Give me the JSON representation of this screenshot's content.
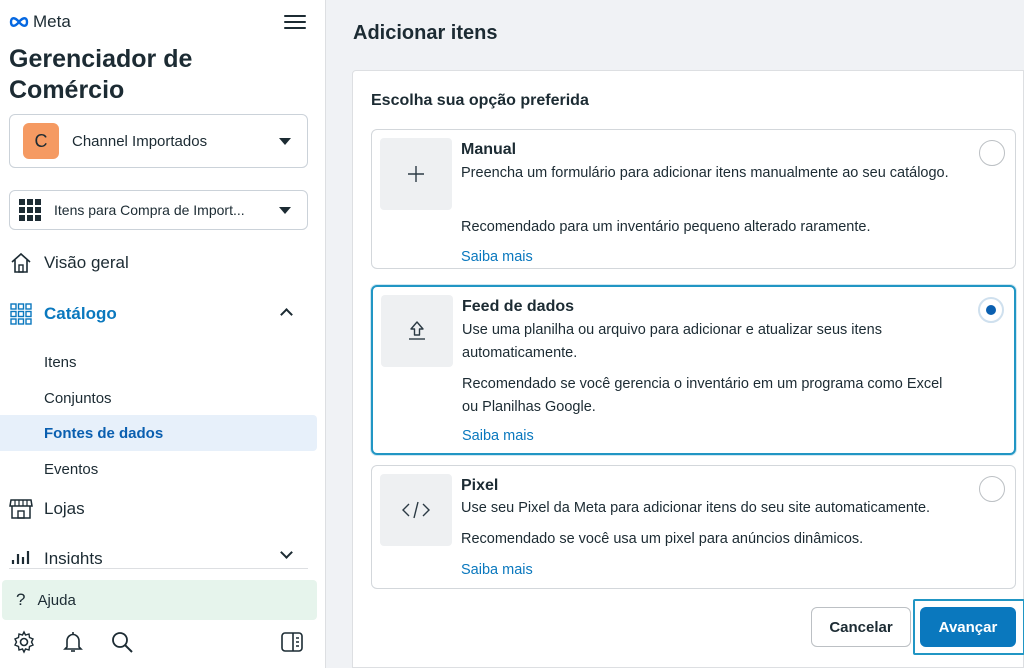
{
  "sidebar": {
    "brand": "Meta",
    "app_title": "Gerenciador de Comércio",
    "account": {
      "initial": "C",
      "name": "Channel Importados"
    },
    "catalog": {
      "name": "Itens para Compra de Import..."
    },
    "nav": {
      "overview": "Visão geral",
      "catalog": "Catálogo",
      "items": "Itens",
      "sets": "Conjuntos",
      "data_sources": "Fontes de dados",
      "events": "Eventos",
      "shops": "Lojas",
      "insights": "Insights"
    },
    "help": "Ajuda",
    "icons": [
      "gear-icon",
      "bell-icon",
      "search-icon",
      "panel-toggle-icon"
    ]
  },
  "main": {
    "title": "Adicionar itens",
    "subtitle": "Escolha sua opção preferida",
    "options": [
      {
        "title": "Manual",
        "desc": "Preencha um formulário para adicionar itens manualmente ao seu catálogo.",
        "rec": "Recomendado para um inventário pequeno alterado raramente.",
        "link": "Saiba mais",
        "icon_glyph": "+",
        "selected": false
      },
      {
        "title": "Feed de dados",
        "desc": "Use uma planilha ou arquivo para adicionar e atualizar seus itens automaticamente.",
        "rec": "Recomendado se você gerencia o inventário em um programa como Excel ou Planilhas Google.",
        "link": "Saiba mais",
        "icon_glyph": "upload",
        "selected": true
      },
      {
        "title": "Pixel",
        "desc": "Use seu Pixel da Meta para adicionar itens do seu site automaticamente.",
        "rec": "Recomendado se você usa um pixel para anúncios dinâmicos.",
        "link": "Saiba mais",
        "icon_glyph": "</>",
        "selected": false
      }
    ],
    "buttons": {
      "cancel": "Cancelar",
      "next": "Avançar"
    }
  },
  "colors": {
    "accent": "#0a78be",
    "selection_border": "#2196c4",
    "active_nav_bg": "#e7f0fa",
    "help_bg": "#e6f4ec",
    "avatar": "#f59a62"
  }
}
